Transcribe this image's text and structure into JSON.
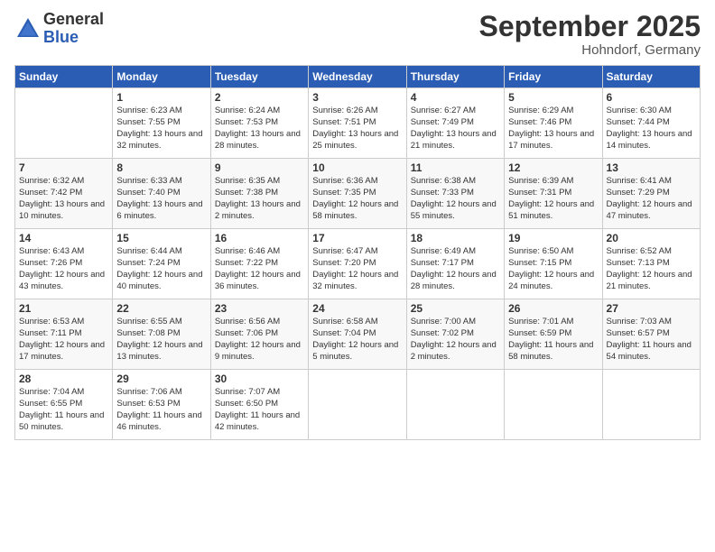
{
  "logo": {
    "general": "General",
    "blue": "Blue"
  },
  "header": {
    "month": "September 2025",
    "location": "Hohndorf, Germany"
  },
  "weekdays": [
    "Sunday",
    "Monday",
    "Tuesday",
    "Wednesday",
    "Thursday",
    "Friday",
    "Saturday"
  ],
  "weeks": [
    [
      {
        "day": "",
        "sunrise": "",
        "sunset": "",
        "daylight": ""
      },
      {
        "day": "1",
        "sunrise": "Sunrise: 6:23 AM",
        "sunset": "Sunset: 7:55 PM",
        "daylight": "Daylight: 13 hours and 32 minutes."
      },
      {
        "day": "2",
        "sunrise": "Sunrise: 6:24 AM",
        "sunset": "Sunset: 7:53 PM",
        "daylight": "Daylight: 13 hours and 28 minutes."
      },
      {
        "day": "3",
        "sunrise": "Sunrise: 6:26 AM",
        "sunset": "Sunset: 7:51 PM",
        "daylight": "Daylight: 13 hours and 25 minutes."
      },
      {
        "day": "4",
        "sunrise": "Sunrise: 6:27 AM",
        "sunset": "Sunset: 7:49 PM",
        "daylight": "Daylight: 13 hours and 21 minutes."
      },
      {
        "day": "5",
        "sunrise": "Sunrise: 6:29 AM",
        "sunset": "Sunset: 7:46 PM",
        "daylight": "Daylight: 13 hours and 17 minutes."
      },
      {
        "day": "6",
        "sunrise": "Sunrise: 6:30 AM",
        "sunset": "Sunset: 7:44 PM",
        "daylight": "Daylight: 13 hours and 14 minutes."
      }
    ],
    [
      {
        "day": "7",
        "sunrise": "Sunrise: 6:32 AM",
        "sunset": "Sunset: 7:42 PM",
        "daylight": "Daylight: 13 hours and 10 minutes."
      },
      {
        "day": "8",
        "sunrise": "Sunrise: 6:33 AM",
        "sunset": "Sunset: 7:40 PM",
        "daylight": "Daylight: 13 hours and 6 minutes."
      },
      {
        "day": "9",
        "sunrise": "Sunrise: 6:35 AM",
        "sunset": "Sunset: 7:38 PM",
        "daylight": "Daylight: 13 hours and 2 minutes."
      },
      {
        "day": "10",
        "sunrise": "Sunrise: 6:36 AM",
        "sunset": "Sunset: 7:35 PM",
        "daylight": "Daylight: 12 hours and 58 minutes."
      },
      {
        "day": "11",
        "sunrise": "Sunrise: 6:38 AM",
        "sunset": "Sunset: 7:33 PM",
        "daylight": "Daylight: 12 hours and 55 minutes."
      },
      {
        "day": "12",
        "sunrise": "Sunrise: 6:39 AM",
        "sunset": "Sunset: 7:31 PM",
        "daylight": "Daylight: 12 hours and 51 minutes."
      },
      {
        "day": "13",
        "sunrise": "Sunrise: 6:41 AM",
        "sunset": "Sunset: 7:29 PM",
        "daylight": "Daylight: 12 hours and 47 minutes."
      }
    ],
    [
      {
        "day": "14",
        "sunrise": "Sunrise: 6:43 AM",
        "sunset": "Sunset: 7:26 PM",
        "daylight": "Daylight: 12 hours and 43 minutes."
      },
      {
        "day": "15",
        "sunrise": "Sunrise: 6:44 AM",
        "sunset": "Sunset: 7:24 PM",
        "daylight": "Daylight: 12 hours and 40 minutes."
      },
      {
        "day": "16",
        "sunrise": "Sunrise: 6:46 AM",
        "sunset": "Sunset: 7:22 PM",
        "daylight": "Daylight: 12 hours and 36 minutes."
      },
      {
        "day": "17",
        "sunrise": "Sunrise: 6:47 AM",
        "sunset": "Sunset: 7:20 PM",
        "daylight": "Daylight: 12 hours and 32 minutes."
      },
      {
        "day": "18",
        "sunrise": "Sunrise: 6:49 AM",
        "sunset": "Sunset: 7:17 PM",
        "daylight": "Daylight: 12 hours and 28 minutes."
      },
      {
        "day": "19",
        "sunrise": "Sunrise: 6:50 AM",
        "sunset": "Sunset: 7:15 PM",
        "daylight": "Daylight: 12 hours and 24 minutes."
      },
      {
        "day": "20",
        "sunrise": "Sunrise: 6:52 AM",
        "sunset": "Sunset: 7:13 PM",
        "daylight": "Daylight: 12 hours and 21 minutes."
      }
    ],
    [
      {
        "day": "21",
        "sunrise": "Sunrise: 6:53 AM",
        "sunset": "Sunset: 7:11 PM",
        "daylight": "Daylight: 12 hours and 17 minutes."
      },
      {
        "day": "22",
        "sunrise": "Sunrise: 6:55 AM",
        "sunset": "Sunset: 7:08 PM",
        "daylight": "Daylight: 12 hours and 13 minutes."
      },
      {
        "day": "23",
        "sunrise": "Sunrise: 6:56 AM",
        "sunset": "Sunset: 7:06 PM",
        "daylight": "Daylight: 12 hours and 9 minutes."
      },
      {
        "day": "24",
        "sunrise": "Sunrise: 6:58 AM",
        "sunset": "Sunset: 7:04 PM",
        "daylight": "Daylight: 12 hours and 5 minutes."
      },
      {
        "day": "25",
        "sunrise": "Sunrise: 7:00 AM",
        "sunset": "Sunset: 7:02 PM",
        "daylight": "Daylight: 12 hours and 2 minutes."
      },
      {
        "day": "26",
        "sunrise": "Sunrise: 7:01 AM",
        "sunset": "Sunset: 6:59 PM",
        "daylight": "Daylight: 11 hours and 58 minutes."
      },
      {
        "day": "27",
        "sunrise": "Sunrise: 7:03 AM",
        "sunset": "Sunset: 6:57 PM",
        "daylight": "Daylight: 11 hours and 54 minutes."
      }
    ],
    [
      {
        "day": "28",
        "sunrise": "Sunrise: 7:04 AM",
        "sunset": "Sunset: 6:55 PM",
        "daylight": "Daylight: 11 hours and 50 minutes."
      },
      {
        "day": "29",
        "sunrise": "Sunrise: 7:06 AM",
        "sunset": "Sunset: 6:53 PM",
        "daylight": "Daylight: 11 hours and 46 minutes."
      },
      {
        "day": "30",
        "sunrise": "Sunrise: 7:07 AM",
        "sunset": "Sunset: 6:50 PM",
        "daylight": "Daylight: 11 hours and 42 minutes."
      },
      {
        "day": "",
        "sunrise": "",
        "sunset": "",
        "daylight": ""
      },
      {
        "day": "",
        "sunrise": "",
        "sunset": "",
        "daylight": ""
      },
      {
        "day": "",
        "sunrise": "",
        "sunset": "",
        "daylight": ""
      },
      {
        "day": "",
        "sunrise": "",
        "sunset": "",
        "daylight": ""
      }
    ]
  ]
}
